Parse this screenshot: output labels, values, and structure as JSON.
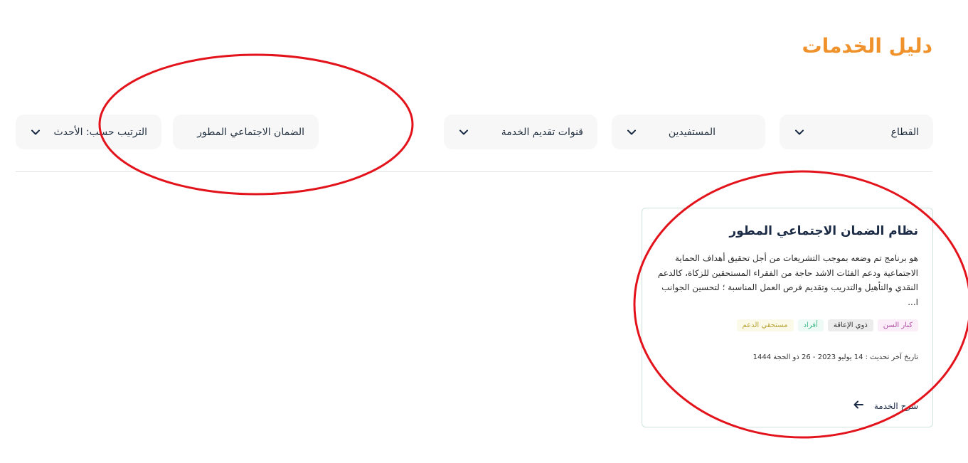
{
  "page": {
    "title": "دليل الخدمات"
  },
  "filters": {
    "sector": "القطاع",
    "beneficiaries": "المستفيدين",
    "channels": "قنوات تقديم الخدمة",
    "search_value": "الضمان الاجتماعي المطور",
    "sort": "الترتيب حسب: الأحدث"
  },
  "card": {
    "title": "نظام الضمان الاجتماعي المطور",
    "description": "هو برنامج تم وضعه بموجب التشريعات من أجل تحقيق أهداف الحماية الاجتماعية ودعم الفئات الاشد حاجة من الفقراء المستحقين للزكاة، كالدعم النقدي والتأهيل والتدريب وتقديم فرص العمل المناسبة ؛ لتحسين الجوانب ا...",
    "tags": [
      "كبار السن",
      "ذوي الإعاقة",
      "أفراد",
      "مستحقي الدعم"
    ],
    "updated": "تاريخ آخر تحديث : 14 يوليو 2023 - 26 ذو الحجة 1444",
    "link": "شرح الخدمة"
  },
  "colors": {
    "accent": "#f0922c",
    "annotation": "#e3131c"
  }
}
